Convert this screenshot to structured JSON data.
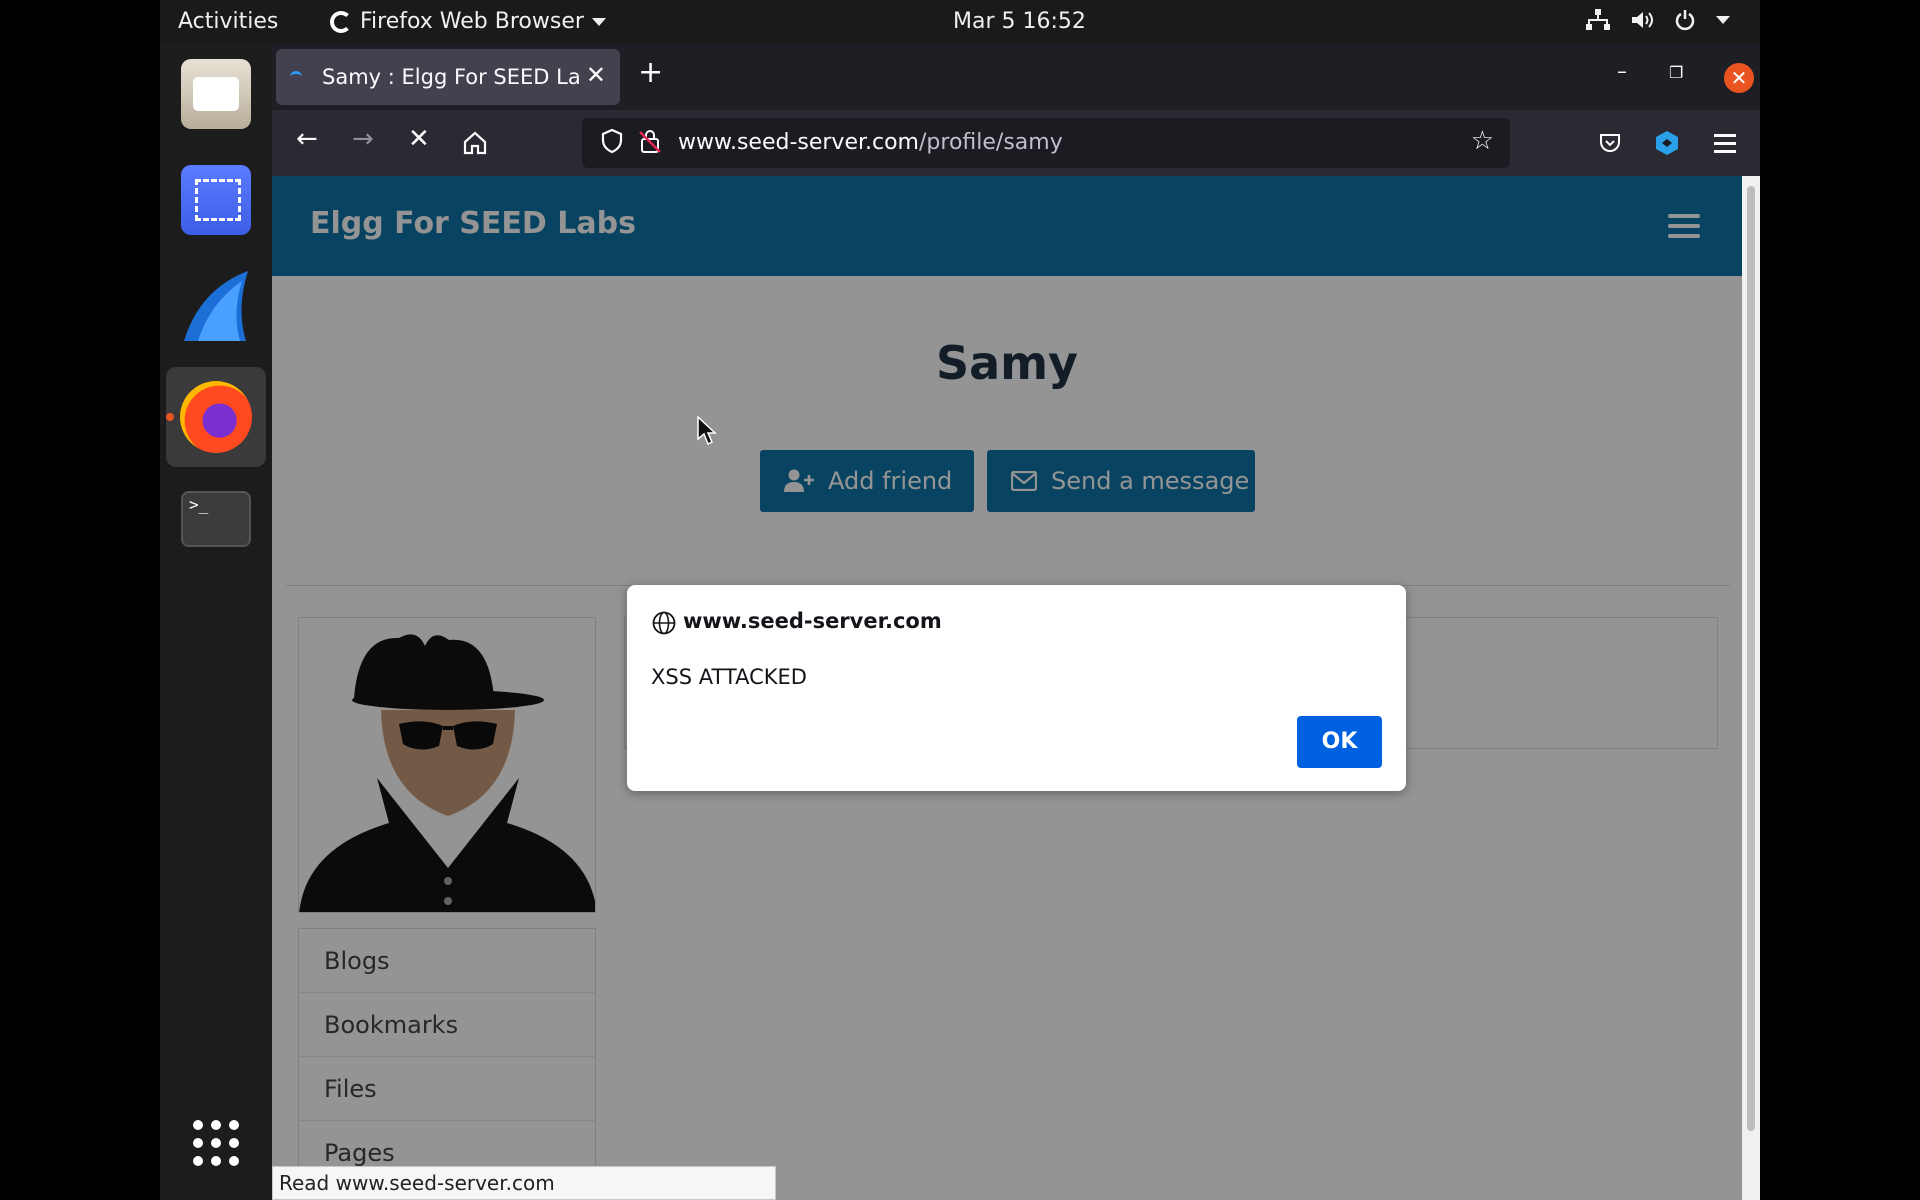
{
  "topbar": {
    "activities": "Activities",
    "app_menu": "Firefox Web Browser",
    "clock": "Mar 5  16:52"
  },
  "dock": {
    "items": [
      "files-icon",
      "screenshot-icon",
      "wireshark-icon",
      "firefox-icon",
      "terminal-icon"
    ],
    "terminal_prompt": ">_"
  },
  "browser": {
    "tab_title": "Samy : Elgg For SEED Labs",
    "url_domain": "www.seed-server.com",
    "url_path": "/profile/samy",
    "status_text": "Read www.seed-server.com"
  },
  "page": {
    "site_title": "Elgg For SEED Labs",
    "profile_name": "Samy",
    "add_friend": "Add friend",
    "send_message": "Send a message",
    "menu": [
      "Blogs",
      "Bookmarks",
      "Files",
      "Pages"
    ]
  },
  "dialog": {
    "origin": "www.seed-server.com",
    "message": "XSS ATTACKED",
    "ok_label": "OK"
  },
  "colors": {
    "site_header": "#0f76a8",
    "ok_button": "#0061e0",
    "close_button": "#e95420"
  }
}
